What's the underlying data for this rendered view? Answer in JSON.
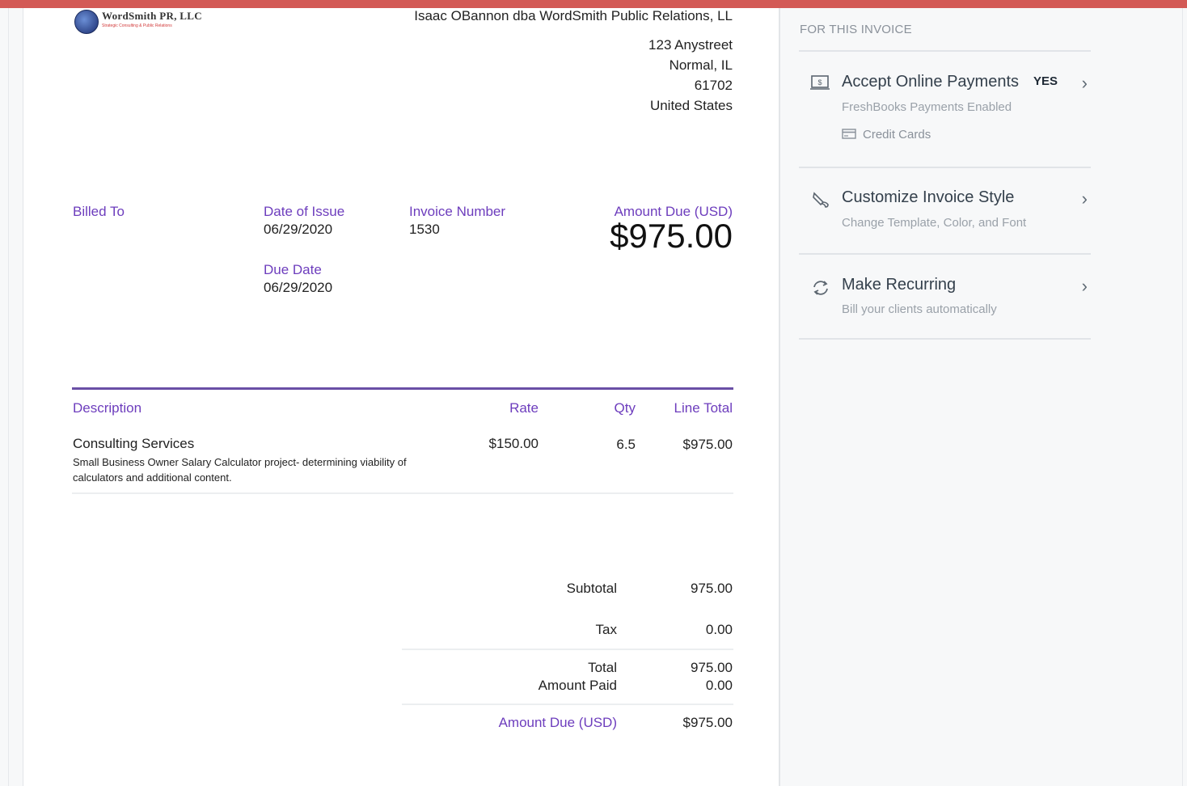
{
  "business": {
    "logo_name": "WordSmith PR, LLC",
    "logo_tagline": "Strategic Consulting & Public Relations",
    "name": "Isaac OBannon dba WordSmith Public Relations, LL",
    "street": "123 Anystreet",
    "city_state": "Normal, IL",
    "zip": "61702",
    "country": "United States"
  },
  "invoice": {
    "billed_to_label": "Billed To",
    "date_of_issue_label": "Date of Issue",
    "date_of_issue": "06/29/2020",
    "due_date_label": "Due Date",
    "due_date": "06/29/2020",
    "invoice_number_label": "Invoice Number",
    "invoice_number": "1530",
    "amount_due_label": "Amount Due (USD)",
    "amount_due": "$975.00"
  },
  "table": {
    "headers": {
      "description": "Description",
      "rate": "Rate",
      "qty": "Qty",
      "line_total": "Line Total"
    },
    "rows": [
      {
        "title": "Consulting Services",
        "description": "Small Business Owner Salary Calculator project- determining viability of calculators and additional content.",
        "rate": "$150.00",
        "qty": "6.5",
        "line_total": "$975.00"
      }
    ]
  },
  "totals": {
    "subtotal_label": "Subtotal",
    "subtotal": "975.00",
    "tax_label": "Tax",
    "tax": "0.00",
    "total_label": "Total",
    "total": "975.00",
    "amount_paid_label": "Amount Paid",
    "amount_paid": "0.00",
    "amount_due_label": "Amount Due (USD)",
    "amount_due": "$975.00"
  },
  "sidebar": {
    "heading": "FOR THIS INVOICE",
    "items": [
      {
        "title": "Accept Online Payments",
        "badge": "YES",
        "subtitle": "FreshBooks Payments Enabled",
        "extra": "Credit Cards",
        "icon": "payment-icon"
      },
      {
        "title": "Customize Invoice Style",
        "subtitle": "Change Template, Color, and Font",
        "icon": "paint-icon"
      },
      {
        "title": "Make Recurring",
        "subtitle": "Bill your clients automatically",
        "icon": "recurring-icon"
      }
    ]
  },
  "colors": {
    "accent": "#6d3dbd",
    "top_bar": "#d35a56",
    "rule": "#6a4fa6"
  }
}
